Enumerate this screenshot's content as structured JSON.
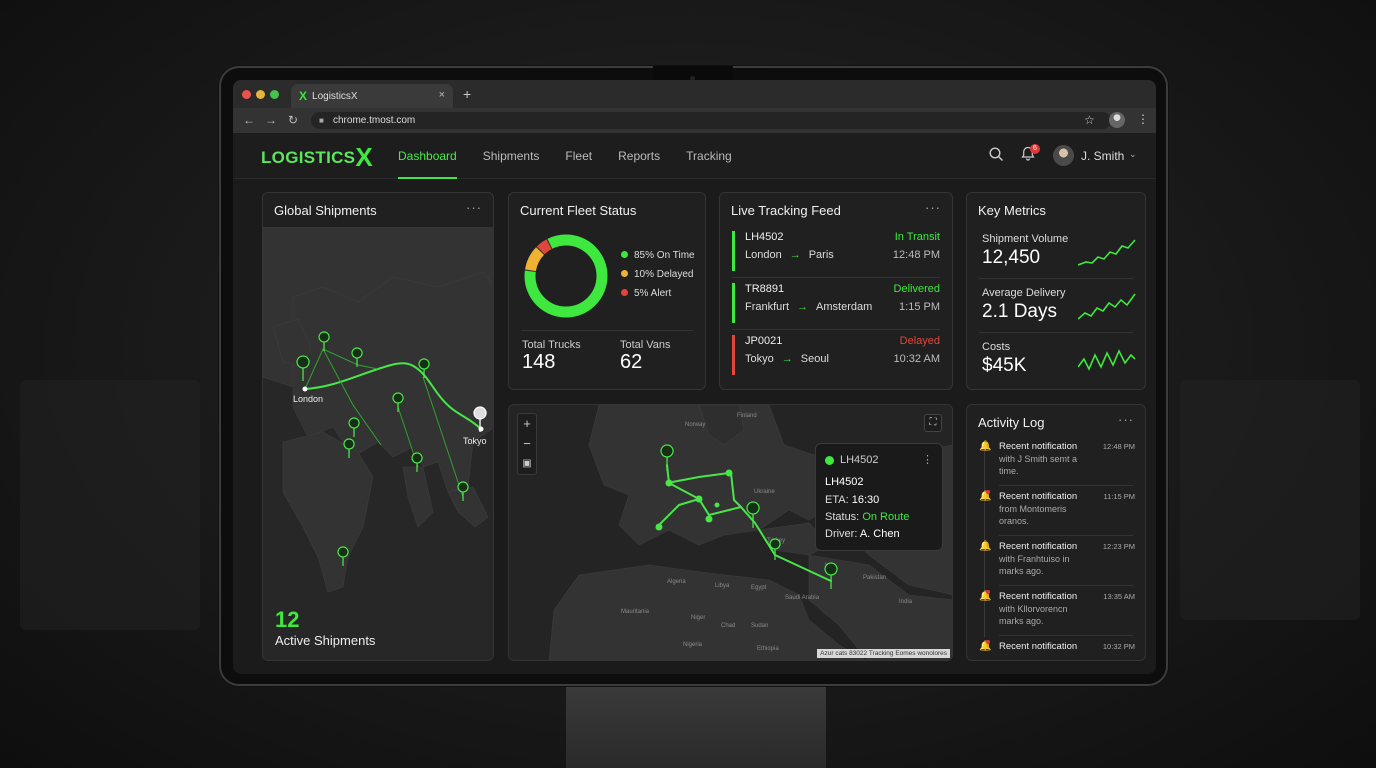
{
  "browser": {
    "tab_title": "LogisticsX",
    "tab_logo": "X",
    "tab_close": "×",
    "new_tab": "+",
    "url": "chrome.tmost.com",
    "icons": {
      "back": "←",
      "forward": "→",
      "reload": "↻",
      "lock": "🔒",
      "star": "☆",
      "menu": "⋮"
    }
  },
  "header": {
    "logo_text": "LOGISTICS",
    "logo_x": "X",
    "nav": [
      {
        "label": "Dashboard",
        "active": true
      },
      {
        "label": "Shipments",
        "active": false
      },
      {
        "label": "Fleet",
        "active": false
      },
      {
        "label": "Reports",
        "active": false
      },
      {
        "label": "Tracking",
        "active": false
      }
    ],
    "notifications_count": "6",
    "user_name": "J. Smith",
    "caret": "⌄"
  },
  "global_shipments": {
    "title": "Global Shipments",
    "more": "···",
    "cities": {
      "london": "London",
      "tokyo": "Tokyo"
    },
    "active_count": "12",
    "active_label": "Active Shipments"
  },
  "fleet_status": {
    "title": "Current Fleet Status",
    "segments": [
      {
        "label": "85% On Time",
        "value": 85,
        "color": "#3ee83e"
      },
      {
        "label": "10% Delayed",
        "value": 10,
        "color": "#f0b233"
      },
      {
        "label": "5% Alert",
        "value": 5,
        "color": "#e0463a"
      }
    ],
    "trucks_label": "Total Trucks",
    "trucks_value": "148",
    "vans_label": "Total Vans",
    "vans_value": "62"
  },
  "tracking_feed": {
    "title": "Live Tracking Feed",
    "more": "···",
    "items": [
      {
        "id": "LH4502",
        "status": "In Transit",
        "status_color": "#3ee83e",
        "from": "London",
        "to": "Paris",
        "time": "12:48 PM",
        "bar_color": "#3ee83e"
      },
      {
        "id": "TR8891",
        "status": "Delivered",
        "status_color": "#3ee83e",
        "from": "Frankfurt",
        "to": "Amsterdam",
        "time": "1:15 PM",
        "bar_color": "#3ee83e"
      },
      {
        "id": "JP0021",
        "status": "Delayed",
        "status_color": "#e0463a",
        "from": "Tokyo",
        "to": "Seoul",
        "time": "10:32 AM",
        "bar_color": "#e0463a"
      }
    ],
    "arrow": "→"
  },
  "key_metrics": {
    "title": "Key Metrics",
    "items": [
      {
        "label": "Shipment Volume",
        "value": "12,450"
      },
      {
        "label": "Average Delivery",
        "value": "2.1 Days"
      },
      {
        "label": "Costs",
        "value": "$45K"
      }
    ]
  },
  "europe_map": {
    "zoom_in": "+",
    "zoom_out": "−",
    "popup": {
      "id_header": "LH4502",
      "id": "LH4502",
      "eta_label": "ETA:",
      "eta": "16:30",
      "status_label": "Status:",
      "status": "On Route",
      "driver_label": "Driver:",
      "driver": "A. Chen",
      "menu": "⋮"
    },
    "countries": [
      "Finland",
      "Norway",
      "Ukraine",
      "Turkey",
      "Algeria",
      "Libya",
      "Egypt",
      "Saudi Arabia",
      "Mauritania",
      "Niger",
      "Chad",
      "Sudan",
      "Nigeria",
      "Ethiopia",
      "Pakistan",
      "India",
      "Iran"
    ],
    "attribution": "Azur cats 83022 Tracking Eomes wonolores"
  },
  "activity_log": {
    "title": "Activity Log",
    "more": "···",
    "items": [
      {
        "title": "Recent notification",
        "text": "with J Smith semt a time.",
        "time": "12:48 PM",
        "alert": false
      },
      {
        "title": "Recent notification",
        "text": "from Montomeris oranos.",
        "time": "11:15 PM",
        "alert": true
      },
      {
        "title": "Recent notification",
        "text": "with Franhtuiso in marks ago.",
        "time": "12:23 PM",
        "alert": false
      },
      {
        "title": "Recent notification",
        "text": "with Kllorvorencn marks ago.",
        "time": "13:35 AM",
        "alert": true
      },
      {
        "title": "Recent notification",
        "text": "",
        "time": "10:32 PM",
        "alert": true
      }
    ]
  },
  "colors": {
    "accent": "#3ee83e",
    "alert": "#e0463a",
    "warning": "#f0b233"
  }
}
